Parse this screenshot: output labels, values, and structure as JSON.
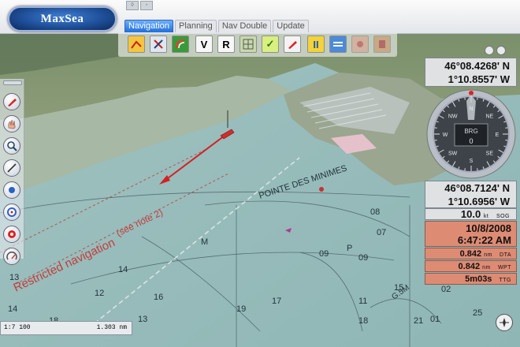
{
  "app": {
    "logo_text": "MaxSea"
  },
  "tabs": [
    {
      "label": "Navigation",
      "active": true
    },
    {
      "label": "Planning",
      "active": false
    },
    {
      "label": "Nav Double",
      "active": false
    },
    {
      "label": "Update",
      "active": false
    }
  ],
  "toolbar": {
    "tools": [
      {
        "name": "route-icon"
      },
      {
        "name": "compass-tool-icon"
      },
      {
        "name": "radar-icon"
      },
      {
        "name": "vector-v-icon",
        "label": "V"
      },
      {
        "name": "range-r-icon",
        "label": "R"
      },
      {
        "name": "chart-grid-icon"
      },
      {
        "name": "checkmark-icon",
        "label": "✓"
      },
      {
        "name": "marker-icon"
      },
      {
        "name": "pause-icon",
        "label": "II"
      },
      {
        "name": "layers-icon"
      },
      {
        "name": "waypoint-icon"
      },
      {
        "name": "arrival-icon"
      }
    ]
  },
  "map": {
    "labels": {
      "restricted": "Restricted navigation",
      "see_note": "(see note 2)",
      "pointe": "POINTE DES MINIMES",
      "g5m": "G.5M"
    },
    "soundings": [
      "14",
      "18",
      "13",
      "12",
      "14",
      "16",
      "19",
      "17",
      "11",
      "18",
      "M",
      "P",
      "21",
      "25",
      "01",
      "02",
      "09",
      "09",
      "07",
      "08",
      "15",
      "13"
    ]
  },
  "position1": {
    "lat": "46°08.4268' N",
    "lon": "1°10.8557' W"
  },
  "compass": {
    "heading_label": "BRG",
    "value": "0",
    "ticks": [
      "N",
      "NE",
      "E",
      "SE",
      "S",
      "SW",
      "W",
      "NW"
    ]
  },
  "position2": {
    "lat": "46°08.7124' N",
    "lon": "1°10.6956' W"
  },
  "sog": {
    "value": "10.0",
    "unit": "kt",
    "label": "SOG"
  },
  "datetime": {
    "date": "10/8/2008",
    "time": "6:47:22 AM"
  },
  "dta": {
    "value": "0.842",
    "unit": "nm",
    "label": "DTA"
  },
  "wpt": {
    "value": "0.842",
    "unit": "nm",
    "label": "WPT"
  },
  "ttg": {
    "value": "5m03s",
    "label": "TTG"
  },
  "scale": {
    "ratio": "1:7 100",
    "distance": "1.303 nm"
  },
  "colors": {
    "accent": "#1f6fd8",
    "salmon": "#de8b74",
    "route": "#d42020"
  }
}
